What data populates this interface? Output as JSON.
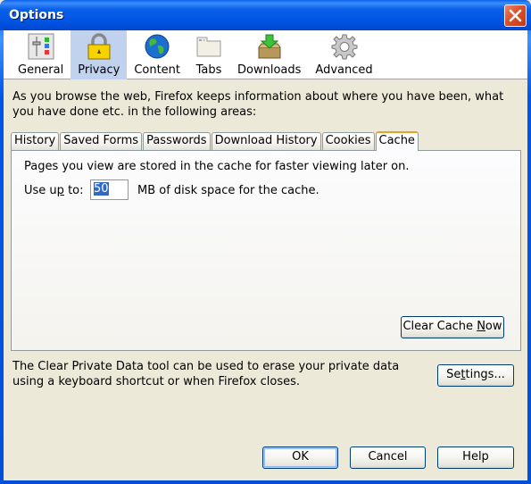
{
  "window": {
    "title": "Options"
  },
  "toolbar": {
    "panes": [
      {
        "label": "General",
        "icon": "general-sliders-icon",
        "selected": false
      },
      {
        "label": "Privacy",
        "icon": "padlock-icon",
        "selected": true
      },
      {
        "label": "Content",
        "icon": "globe-icon",
        "selected": false
      },
      {
        "label": "Tabs",
        "icon": "tabs-window-icon",
        "selected": false
      },
      {
        "label": "Downloads",
        "icon": "download-box-icon",
        "selected": false
      },
      {
        "label": "Advanced",
        "icon": "gear-icon",
        "selected": false
      }
    ]
  },
  "privacy": {
    "intro": "As you browse the web, Firefox keeps information about where you have been, what you have done etc. in the following areas:",
    "tabs": [
      {
        "label": "History",
        "selected": false
      },
      {
        "label": "Saved Forms",
        "selected": false
      },
      {
        "label": "Passwords",
        "selected": false
      },
      {
        "label": "Download History",
        "selected": false
      },
      {
        "label": "Cookies",
        "selected": false
      },
      {
        "label": "Cache",
        "selected": true
      }
    ],
    "cache": {
      "description": "Pages you view are stored in the cache for faster viewing later on.",
      "use_up_to_pre": "Use u",
      "use_up_to_accel": "p",
      "use_up_to_post": " to:",
      "size_value": "50",
      "size_suffix": "MB of disk space for the cache.",
      "clear_button_pre": "Clear Cache ",
      "clear_button_accel": "N",
      "clear_button_post": "ow"
    },
    "private_data": {
      "text": "The Clear Private Data tool can be used to erase your private data using a keyboard shortcut or when Firefox closes.",
      "settings_pre": "Se",
      "settings_accel": "t",
      "settings_post": "tings..."
    }
  },
  "dialog_buttons": {
    "ok": "OK",
    "cancel": "Cancel",
    "help": "Help"
  },
  "colors": {
    "titlebar": "#0054e3",
    "selected_pane": "#c1d2ee",
    "selected_tab_accent": "#e6a32c",
    "close_button": "#d9512c",
    "selection_highlight": "#316ac5"
  }
}
